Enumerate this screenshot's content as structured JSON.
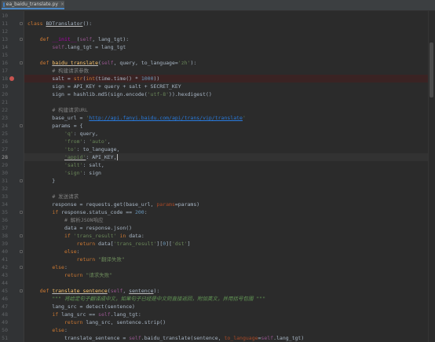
{
  "tab": {
    "filename": "ea_baidu_translate.py",
    "close": "×"
  },
  "lines": [
    {
      "num": "10",
      "tokens": []
    },
    {
      "num": "11",
      "tokens": [
        {
          "t": "class ",
          "c": "k"
        },
        {
          "t": "BDTranslator",
          "c": "cn u"
        },
        {
          "t": "():"
        }
      ]
    },
    {
      "num": "12",
      "tokens": []
    },
    {
      "num": "13",
      "tokens": [
        {
          "t": "    "
        },
        {
          "t": "def ",
          "c": "k"
        },
        {
          "t": "__init__",
          "c": "magic"
        },
        {
          "t": "("
        },
        {
          "t": "self",
          "c": "self"
        },
        {
          "t": ", lang_tgt):"
        }
      ]
    },
    {
      "num": "14",
      "tokens": [
        {
          "t": "        "
        },
        {
          "t": "self",
          "c": "self"
        },
        {
          "t": ".lang_tgt = lang_tgt"
        }
      ]
    },
    {
      "num": "15",
      "tokens": []
    },
    {
      "num": "16",
      "tokens": [
        {
          "t": "    "
        },
        {
          "t": "def ",
          "c": "k"
        },
        {
          "t": "baidu_translate",
          "c": "fn u"
        },
        {
          "t": "("
        },
        {
          "t": "self",
          "c": "self"
        },
        {
          "t": ", query, to_language="
        },
        {
          "t": "'zh'",
          "c": "s"
        },
        {
          "t": "):"
        }
      ]
    },
    {
      "num": "17",
      "tokens": [
        {
          "t": "        "
        },
        {
          "t": "# 构建请求参数",
          "c": "c"
        }
      ]
    },
    {
      "num": "18",
      "tokens": [
        {
          "t": "        salt = "
        },
        {
          "t": "str",
          "c": "k"
        },
        {
          "t": "("
        },
        {
          "t": "int",
          "c": "k"
        },
        {
          "t": "(time.time() * "
        },
        {
          "t": "1000",
          "c": "n"
        },
        {
          "t": "))"
        }
      ],
      "mark": "bp"
    },
    {
      "num": "19",
      "tokens": [
        {
          "t": "        sign = API_KEY + query + salt + SECRET_KEY"
        }
      ]
    },
    {
      "num": "20",
      "tokens": [
        {
          "t": "        sign = hashlib.md5(sign.encode("
        },
        {
          "t": "'utf-8'",
          "c": "s"
        },
        {
          "t": ")).hexdigest()"
        }
      ]
    },
    {
      "num": "21",
      "tokens": []
    },
    {
      "num": "22",
      "tokens": [
        {
          "t": "        "
        },
        {
          "t": "# 构建请求URL",
          "c": "c"
        }
      ]
    },
    {
      "num": "23",
      "tokens": [
        {
          "t": "        base_url = "
        },
        {
          "t": "'",
          "c": "s"
        },
        {
          "t": "http://api.fanyi.baidu.com/api/trans/vip/translate",
          "c": "url"
        },
        {
          "t": "'",
          "c": "s"
        }
      ]
    },
    {
      "num": "24",
      "tokens": [
        {
          "t": "        params = {"
        }
      ]
    },
    {
      "num": "25",
      "tokens": [
        {
          "t": "            "
        },
        {
          "t": "'q'",
          "c": "s"
        },
        {
          "t": ": query,"
        }
      ]
    },
    {
      "num": "26",
      "tokens": [
        {
          "t": "            "
        },
        {
          "t": "'from'",
          "c": "s"
        },
        {
          "t": ": "
        },
        {
          "t": "'auto'",
          "c": "s"
        },
        {
          "t": ","
        }
      ]
    },
    {
      "num": "27",
      "tokens": [
        {
          "t": "            "
        },
        {
          "t": "'to'",
          "c": "s"
        },
        {
          "t": ": to_language,"
        }
      ]
    },
    {
      "num": "28",
      "tokens": [
        {
          "t": "            "
        },
        {
          "t": "'appid'",
          "c": "s u"
        },
        {
          "t": ": API_KEY,"
        },
        {
          "caret": true
        }
      ],
      "current": true
    },
    {
      "num": "29",
      "tokens": [
        {
          "t": "            "
        },
        {
          "t": "'salt'",
          "c": "s"
        },
        {
          "t": ": salt,"
        }
      ]
    },
    {
      "num": "30",
      "tokens": [
        {
          "t": "            "
        },
        {
          "t": "'sign'",
          "c": "s"
        },
        {
          "t": ": sign"
        }
      ]
    },
    {
      "num": "31",
      "tokens": [
        {
          "t": "        }"
        }
      ]
    },
    {
      "num": "32",
      "tokens": []
    },
    {
      "num": "33",
      "tokens": [
        {
          "t": "        "
        },
        {
          "t": "# 发送请求",
          "c": "c"
        }
      ]
    },
    {
      "num": "34",
      "tokens": [
        {
          "t": "        response = requests.get(base_url, "
        },
        {
          "t": "params",
          "c": "param"
        },
        {
          "t": "=params)"
        }
      ]
    },
    {
      "num": "35",
      "tokens": [
        {
          "t": "        "
        },
        {
          "t": "if ",
          "c": "k"
        },
        {
          "t": "response.status_code == "
        },
        {
          "t": "200",
          "c": "n"
        },
        {
          "t": ":"
        }
      ]
    },
    {
      "num": "36",
      "tokens": [
        {
          "t": "            "
        },
        {
          "t": "# 解析JSON响应",
          "c": "c"
        }
      ]
    },
    {
      "num": "37",
      "tokens": [
        {
          "t": "            data = response.json()"
        }
      ]
    },
    {
      "num": "38",
      "tokens": [
        {
          "t": "            "
        },
        {
          "t": "if ",
          "c": "k"
        },
        {
          "t": "'trans_result'",
          "c": "s"
        },
        {
          "t": " "
        },
        {
          "t": "in ",
          "c": "k"
        },
        {
          "t": "data:"
        }
      ]
    },
    {
      "num": "39",
      "tokens": [
        {
          "t": "                "
        },
        {
          "t": "return ",
          "c": "k"
        },
        {
          "t": "data["
        },
        {
          "t": "'trans_result'",
          "c": "s"
        },
        {
          "t": "]["
        },
        {
          "t": "0",
          "c": "n"
        },
        {
          "t": "]["
        },
        {
          "t": "'dst'",
          "c": "s"
        },
        {
          "t": "]"
        }
      ]
    },
    {
      "num": "40",
      "tokens": [
        {
          "t": "            "
        },
        {
          "t": "else",
          "c": "k"
        },
        {
          "t": ":"
        }
      ]
    },
    {
      "num": "41",
      "tokens": [
        {
          "t": "                "
        },
        {
          "t": "return ",
          "c": "k"
        },
        {
          "t": "\"翻译失败\"",
          "c": "s"
        }
      ]
    },
    {
      "num": "42",
      "tokens": [
        {
          "t": "        "
        },
        {
          "t": "else",
          "c": "k"
        },
        {
          "t": ":"
        }
      ]
    },
    {
      "num": "43",
      "tokens": [
        {
          "t": "            "
        },
        {
          "t": "return ",
          "c": "k"
        },
        {
          "t": "\"请求失败\"",
          "c": "s"
        }
      ]
    },
    {
      "num": "44",
      "tokens": []
    },
    {
      "num": "45",
      "tokens": [
        {
          "t": "    "
        },
        {
          "t": "def ",
          "c": "k"
        },
        {
          "t": "translate_sentence",
          "c": "fn u"
        },
        {
          "t": "("
        },
        {
          "t": "self",
          "c": "self"
        },
        {
          "t": ", "
        },
        {
          "t": "sentence",
          "c": "u"
        },
        {
          "t": "):"
        }
      ]
    },
    {
      "num": "46",
      "tokens": [
        {
          "t": "        "
        },
        {
          "t": "\"\"\" 将给定句子翻译成中文，如果句子已经是中文则直接返回，附加英文，并用括号包围 \"\"\"",
          "c": "doc"
        }
      ]
    },
    {
      "num": "47",
      "tokens": [
        {
          "t": "        lang_src = detect(sentence)"
        }
      ]
    },
    {
      "num": "48",
      "tokens": [
        {
          "t": "        "
        },
        {
          "t": "if ",
          "c": "k"
        },
        {
          "t": "lang_src == "
        },
        {
          "t": "self",
          "c": "self"
        },
        {
          "t": ".lang_tgt:"
        }
      ]
    },
    {
      "num": "49",
      "tokens": [
        {
          "t": "            "
        },
        {
          "t": "return ",
          "c": "k"
        },
        {
          "t": "lang_src, sentence.strip()"
        }
      ]
    },
    {
      "num": "50",
      "tokens": [
        {
          "t": "        "
        },
        {
          "t": "else",
          "c": "k"
        },
        {
          "t": ":"
        }
      ]
    },
    {
      "num": "51",
      "tokens": [
        {
          "t": "            translate_sentence = "
        },
        {
          "t": "self",
          "c": "self"
        },
        {
          "t": ".baidu_translate(sentence, "
        },
        {
          "t": "to_language",
          "c": "param"
        },
        {
          "t": "="
        },
        {
          "t": "self",
          "c": "self"
        },
        {
          "t": ".lang_tgt)"
        }
      ]
    }
  ],
  "colors": {
    "background": "#2b2b2b",
    "gutter": "#313335",
    "keyword": "#cc7832",
    "string": "#6a8759",
    "comment": "#808080",
    "number": "#6897bb",
    "self": "#94558d",
    "function": "#ffc66d"
  },
  "icons": {
    "file": "python-file-icon",
    "breakpoint": "breakpoint-icon",
    "fold": "fold-marker-icon"
  }
}
